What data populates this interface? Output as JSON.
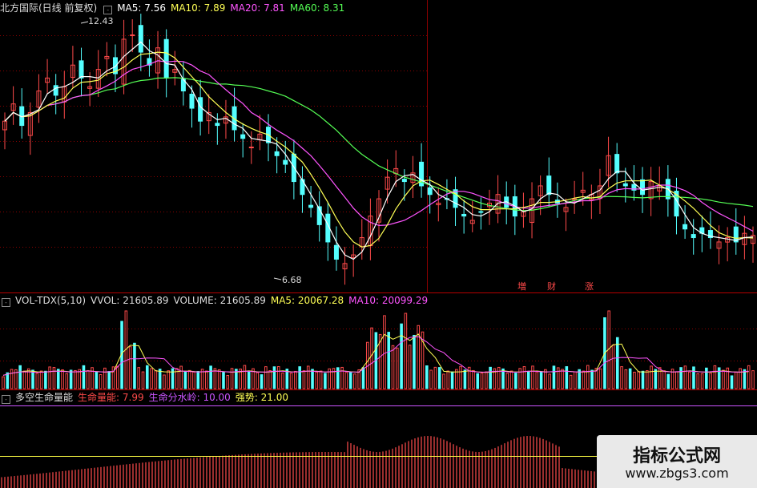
{
  "colors": {
    "up": "#ff4a4a",
    "down": "#54ffff",
    "ma5": "#ffffff",
    "ma10": "#ffff55",
    "ma20": "#ff55ff",
    "ma60": "#55ff55",
    "grid": "#8a0000",
    "sep": "#b40000",
    "purple": "#cc55ff",
    "yellow": "#ffff44"
  },
  "price_panel": {
    "title": "北方国际(日线 前复权)",
    "ma5": "MA5: 7.56",
    "ma10": "MA10: 7.89",
    "ma20": "MA20: 7.81",
    "ma60": "MA60: 8.31",
    "high_label": "12.43",
    "low_label": "6.68",
    "markers": [
      "増",
      "财",
      "涨"
    ]
  },
  "volume_panel": {
    "title": "VOL-TDX(5,10)",
    "vvol": "VVOL: 21605.89",
    "volume": "VOLUME: 21605.89",
    "ma5": "MA5: 20067.28",
    "ma10": "MA10: 20099.29"
  },
  "indicator_panel": {
    "title": "多空生命量能",
    "life": "生命量能: 7.99",
    "watermark": "生命分水岭: 10.00",
    "strong": "强势: 21.00"
  },
  "watermark": {
    "line1": "指标公式网",
    "line2": "www.zbgs3.com"
  },
  "chart_data": {
    "type": "candlestick",
    "closes": [
      10.2,
      10.6,
      10.1,
      10.4,
      10.9,
      11.2,
      10.8,
      11.0,
      11.5,
      11.2,
      11.0,
      11.4,
      11.7,
      11.3,
      12.1,
      12.2,
      11.8,
      11.5,
      11.9,
      11.2,
      11.4,
      10.9,
      10.5,
      10.2,
      10.4,
      10.1,
      10.3,
      10.0,
      9.8,
      9.6,
      9.9,
      9.7,
      9.4,
      9.2,
      8.8,
      8.5,
      8.2,
      7.8,
      7.4,
      7.0,
      6.9,
      7.1,
      7.5,
      8.0,
      8.4,
      8.9,
      9.1,
      8.8,
      9.0,
      8.7,
      8.5,
      8.3,
      8.4,
      8.2,
      8.0,
      7.9,
      8.1,
      8.3,
      8.5,
      8.2,
      8.0,
      8.1,
      8.4,
      8.7,
      8.5,
      8.3,
      8.2,
      8.4,
      8.6,
      8.5,
      8.7,
      9.4,
      9.0,
      8.7,
      8.6,
      8.5,
      8.8,
      8.7,
      8.4,
      8.0,
      7.7,
      7.5,
      7.6,
      7.5,
      7.4,
      7.5,
      7.4,
      7.6,
      7.55
    ],
    "vol_ma5_last": 20067.28,
    "vol_ma10_last": 20099.29,
    "life_energy": 7.99,
    "life_watershed": 10.0,
    "strong": 21.0
  }
}
